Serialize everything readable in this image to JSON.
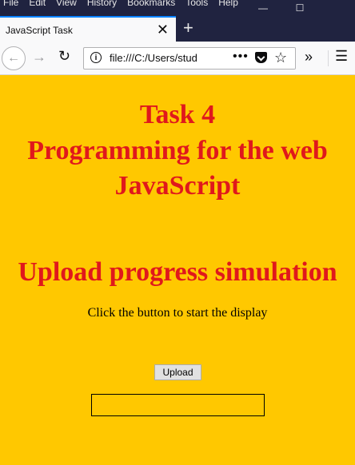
{
  "menubar": {
    "items": [
      "File",
      "Edit",
      "View",
      "History",
      "Bookmarks",
      "Tools",
      "Help"
    ]
  },
  "tab": {
    "title": "JavaScript Task",
    "close_icon": "close-icon"
  },
  "newtab": {
    "icon": "plus-icon"
  },
  "navbar": {
    "url": "file:///C:/Users/stud"
  },
  "page": {
    "heading_line1": "Task 4",
    "heading_line2": "Programming for the web",
    "heading_line3": "JavaScript",
    "subheading": "Upload progress simulation",
    "instruction": "Click the button to start the display",
    "button_label": "Upload",
    "progress_fraction": 0
  },
  "colors": {
    "page_background": "#ffc800",
    "heading": "#e0181c",
    "titlebar": "#202340"
  }
}
